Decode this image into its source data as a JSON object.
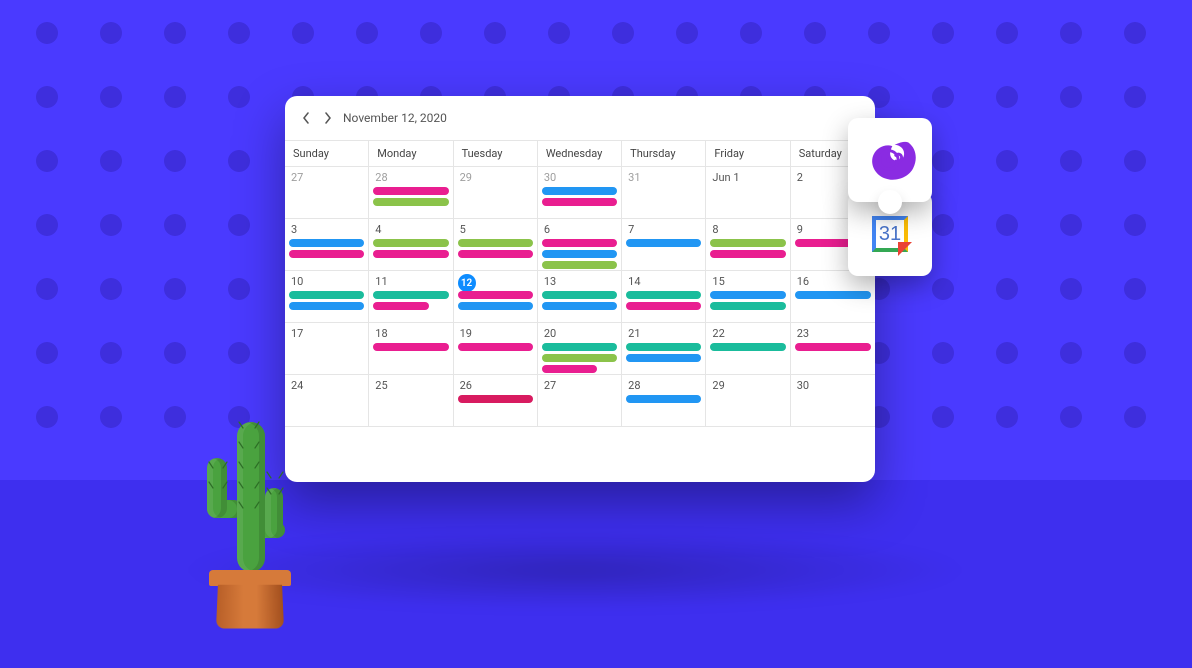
{
  "toolbar": {
    "title": "November 12, 2020"
  },
  "day_headers": [
    "Sunday",
    "Monday",
    "Tuesday",
    "Wednesday",
    "Thursday",
    "Friday",
    "Saturday"
  ],
  "weeks": [
    [
      {
        "label": "27",
        "muted": true,
        "events": []
      },
      {
        "label": "28",
        "muted": true,
        "events": [
          {
            "c": "pink"
          },
          {
            "c": "green"
          }
        ]
      },
      {
        "label": "29",
        "muted": true,
        "events": []
      },
      {
        "label": "30",
        "muted": true,
        "events": [
          {
            "c": "blue"
          },
          {
            "c": "pink"
          }
        ]
      },
      {
        "label": "31",
        "muted": true,
        "events": []
      },
      {
        "label": "Jun 1",
        "events": []
      },
      {
        "label": "2",
        "events": []
      }
    ],
    [
      {
        "label": "3",
        "events": [
          {
            "c": "blue"
          },
          {
            "c": "pink"
          }
        ]
      },
      {
        "label": "4",
        "events": [
          {
            "c": "green"
          },
          {
            "c": "pink"
          }
        ]
      },
      {
        "label": "5",
        "events": [
          {
            "c": "green"
          },
          {
            "c": "pink"
          }
        ]
      },
      {
        "label": "6",
        "events": [
          {
            "c": "pink"
          },
          {
            "c": "blue"
          },
          {
            "c": "green"
          }
        ]
      },
      {
        "label": "7",
        "events": [
          {
            "c": "blue"
          }
        ]
      },
      {
        "label": "8",
        "events": [
          {
            "c": "green"
          },
          {
            "c": "pink"
          }
        ]
      },
      {
        "label": "9",
        "events": [
          {
            "c": "pink"
          }
        ]
      }
    ],
    [
      {
        "label": "10",
        "events": [
          {
            "c": "teal"
          },
          {
            "c": "blue"
          }
        ]
      },
      {
        "label": "11",
        "events": [
          {
            "c": "teal"
          },
          {
            "c": "pink",
            "w": 70
          }
        ]
      },
      {
        "label": "12",
        "today": true,
        "events": [
          {
            "c": "pink"
          },
          {
            "c": "blue"
          }
        ]
      },
      {
        "label": "13",
        "events": [
          {
            "c": "teal"
          },
          {
            "c": "blue"
          }
        ]
      },
      {
        "label": "14",
        "events": [
          {
            "c": "teal"
          },
          {
            "c": "pink"
          }
        ]
      },
      {
        "label": "15",
        "events": [
          {
            "c": "blue"
          },
          {
            "c": "teal"
          }
        ]
      },
      {
        "label": "16",
        "events": [
          {
            "c": "blue"
          }
        ]
      }
    ],
    [
      {
        "label": "17",
        "events": []
      },
      {
        "label": "18",
        "events": [
          {
            "c": "pink"
          }
        ]
      },
      {
        "label": "19",
        "events": [
          {
            "c": "pink"
          }
        ]
      },
      {
        "label": "20",
        "events": [
          {
            "c": "teal"
          },
          {
            "c": "green"
          },
          {
            "c": "pink",
            "w": 70
          }
        ]
      },
      {
        "label": "21",
        "events": [
          {
            "c": "teal"
          },
          {
            "c": "blue"
          }
        ]
      },
      {
        "label": "22",
        "events": [
          {
            "c": "teal"
          }
        ]
      },
      {
        "label": "23",
        "events": [
          {
            "c": "pink"
          }
        ]
      }
    ],
    [
      {
        "label": "24",
        "events": []
      },
      {
        "label": "25",
        "events": []
      },
      {
        "label": "26",
        "events": [
          {
            "c": "magenta"
          }
        ]
      },
      {
        "label": "27",
        "events": []
      },
      {
        "label": "28",
        "events": [
          {
            "c": "blue"
          }
        ]
      },
      {
        "label": "29",
        "events": []
      },
      {
        "label": "30",
        "events": []
      }
    ]
  ],
  "colors": {
    "pink": "#e91e90",
    "green": "#8bc34a",
    "blue": "#2196f3",
    "teal": "#1abc9c",
    "magenta": "#d81b60"
  },
  "badges": {
    "gcal_day": "31"
  }
}
